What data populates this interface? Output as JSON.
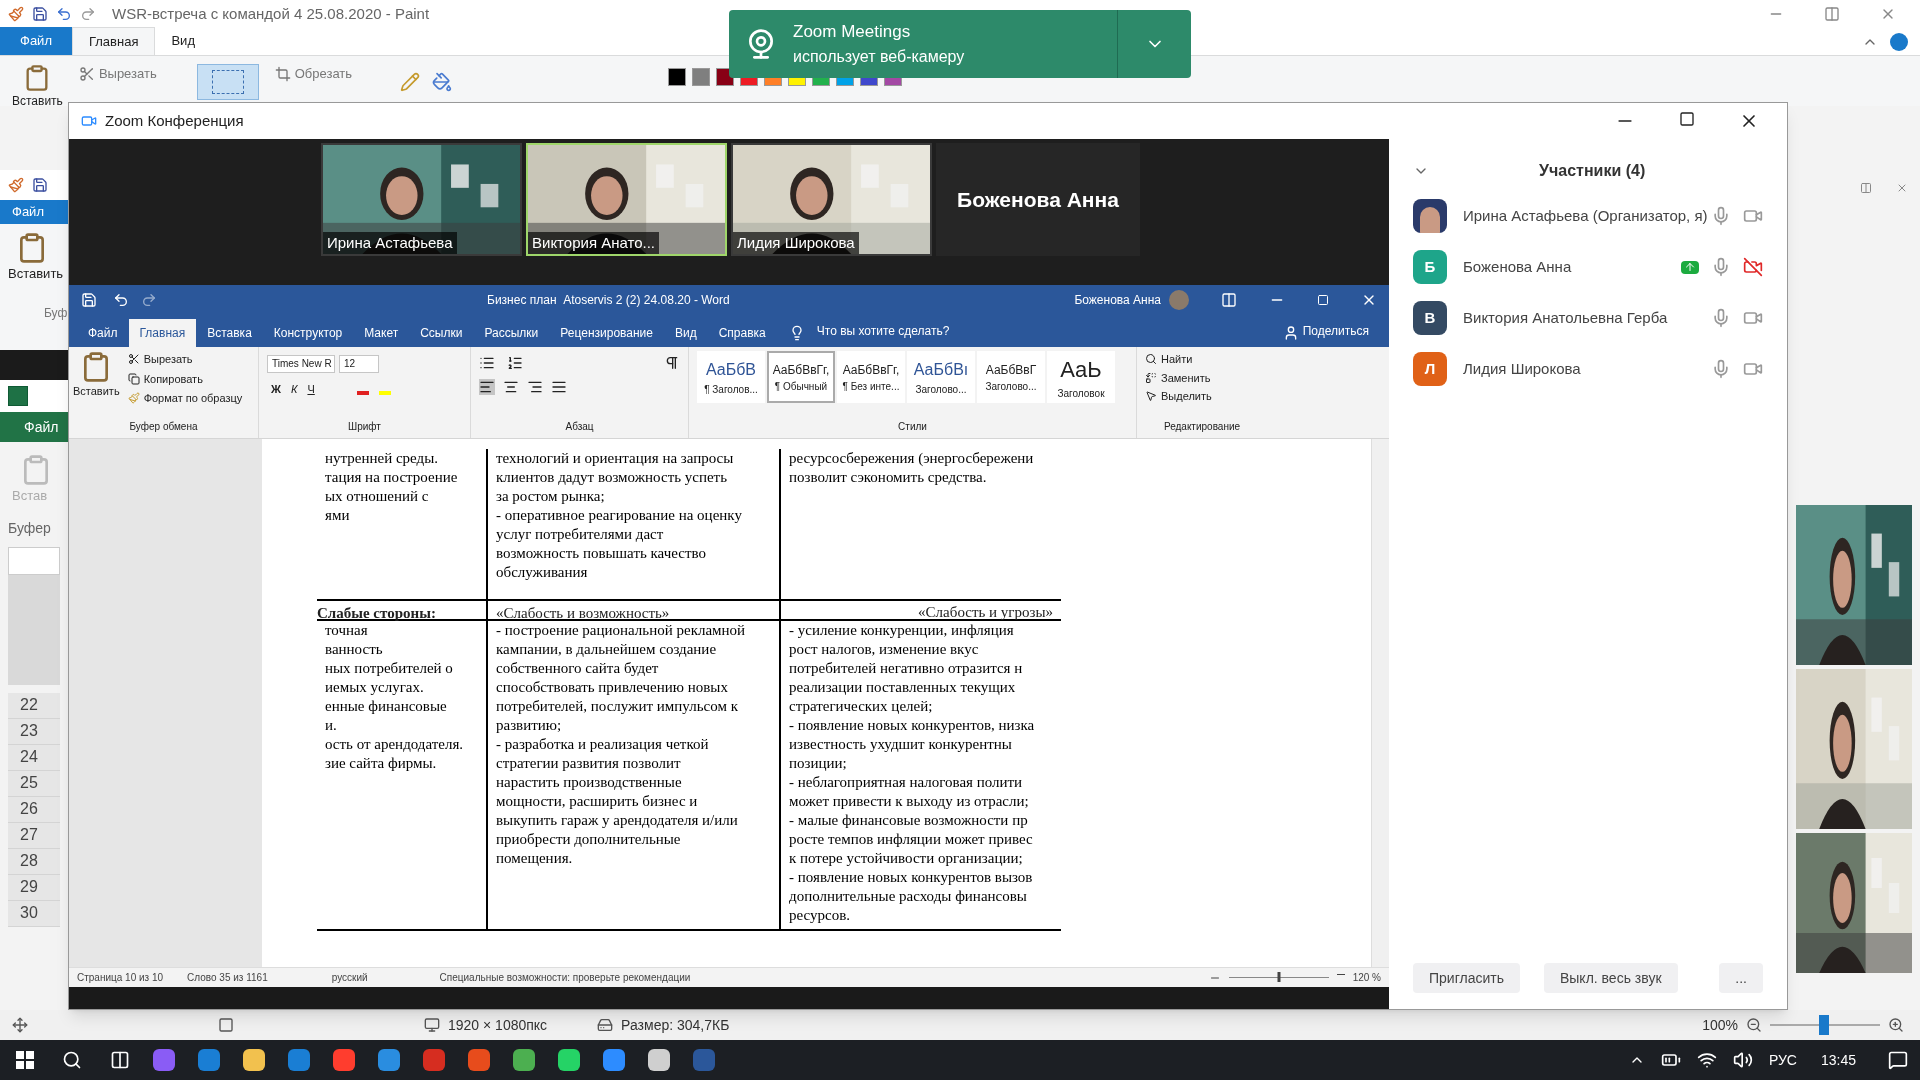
{
  "paint": {
    "title": "WSR-встреча с командой 4 25.08.2020 - Paint",
    "tabs": [
      {
        "label": "Файл",
        "kind": "file",
        "selected": false
      },
      {
        "label": "Главная",
        "kind": "tab",
        "selected": true
      },
      {
        "label": "Вид",
        "kind": "tab",
        "selected": false
      }
    ],
    "ribbon": {
      "paste": "Вставить",
      "cut": "Вырезать",
      "crop": "Обрезать"
    },
    "status": {
      "dimensions": "1920 × 1080пкс",
      "size": "Размер: 304,7КБ",
      "zoom": "100%",
      "level": 0.49
    }
  },
  "toast": {
    "title": "Zoom Meetings",
    "message": "использует веб-камеру"
  },
  "paint_back": {
    "file": "Файл",
    "paste": "Вставить",
    "group": "Буф"
  },
  "excel": {
    "file": "Файл",
    "paste": "Встав",
    "group": "Буфер",
    "rows": [
      "22",
      "23",
      "24",
      "25",
      "26",
      "27",
      "28",
      "29",
      "30"
    ]
  },
  "zoom": {
    "title": "Zoom Конференция",
    "videos": [
      {
        "name": "Ирина Астафьева",
        "selected": false
      },
      {
        "name": "Виктория Анато...",
        "selected": true
      },
      {
        "name": "Лидия Широкова",
        "selected": false
      }
    ],
    "name_tile": "Боженова Анна",
    "participants": {
      "title": "Участники (4)",
      "items": [
        {
          "name": "Ирина Астафьева (Организатор, я)",
          "video_off": false,
          "sharing": false
        },
        {
          "name": "Боженова Анна",
          "kind": "initial",
          "initial": "Б",
          "color": "#1ea58a",
          "video_off": true,
          "sharing": true
        },
        {
          "name": "Виктория Анатольевна Герба",
          "kind": "initial",
          "initial": "В",
          "color": "#344a63",
          "video_off": false,
          "sharing": false
        },
        {
          "name": "Лидия Широкова",
          "kind": "initial",
          "initial": "Л",
          "color": "#e06117",
          "video_off": false,
          "sharing": false
        }
      ]
    },
    "buttons": [
      "Пригласить",
      "Выкл. весь звук",
      "..."
    ]
  },
  "word": {
    "title": "Бизнес план  Atoservis 2 (2) 24.08.20 - Word",
    "user": "Боженова Анна",
    "tabs": [
      {
        "label": "Файл",
        "selected": false
      },
      {
        "label": "Главная",
        "selected": true
      },
      {
        "label": "Вставка",
        "selected": false
      },
      {
        "label": "Конструктор",
        "selected": false
      },
      {
        "label": "Макет",
        "selected": false
      },
      {
        "label": "Ссылки",
        "selected": false
      },
      {
        "label": "Рассылки",
        "selected": false
      },
      {
        "label": "Рецензирование",
        "selected": false
      },
      {
        "label": "Вид",
        "selected": false
      },
      {
        "label": "Справка",
        "selected": false
      }
    ],
    "tell_me": "Что вы хотите сделать?",
    "share": "Поделиться",
    "clipboard": {
      "paste": "Вставить",
      "cut": "Вырезать",
      "copy": "Копировать",
      "format": "Формат по образцу",
      "group": "Буфер обмена"
    },
    "font": {
      "name": "Times New R",
      "size": "12",
      "format": [
        "Ж",
        "К",
        "Ч"
      ],
      "group": "Шрифт"
    },
    "paragraph": {
      "group": "Абзац"
    },
    "styles": {
      "group": "Стили",
      "items": [
        {
          "preview": "АаБбВ",
          "label": "¶ Заголов...",
          "selected": false
        },
        {
          "preview": "АаБбВвГг,",
          "label": "¶ Обычный",
          "selected": true
        },
        {
          "preview": "АаБбВвГг,",
          "label": "¶ Без инте...",
          "selected": false
        },
        {
          "preview": "АаБбВı",
          "label": "Заголово...",
          "selected": false
        },
        {
          "preview": "АаБбВвГ",
          "label": "Заголово...",
          "selected": false
        },
        {
          "preview": "АаЬ",
          "label": "Заголовок",
          "selected": false
        }
      ]
    },
    "editing": {
      "find": "Найти",
      "replace": "Заменить",
      "select": "Выделить",
      "group": "Редактирование"
    },
    "table": {
      "top_row": [
        [
          "нутренней среды.",
          "тация на построение",
          "ых отношений с",
          "ями"
        ],
        [
          "технологий и ориентация на запросы",
          "клиентов дадут возможность успеть",
          "за ростом рынка;",
          "- оперативное реагирование на оценку",
          "услуг потребителями даст",
          "возможность повышать качество",
          "обслуживания"
        ],
        [
          "ресурсосбережения (энергосбережени",
          "позволит сэкономить средства."
        ]
      ],
      "header": [
        "Слабые стороны:",
        "«Слабость и возможность»",
        "«Слабость и угрозы»"
      ],
      "body_row": [
        [
          "точная",
          "ванность",
          "ных потребителей о",
          "иемых услугах.",
          "енные финансовые",
          "и.",
          "ость от арендодателя.",
          "зие сайта фирмы."
        ],
        [
          "- построение рациональной рекламной",
          "кампании, в дальнейшем создание",
          "собственного сайта будет",
          "способствовать привлечению новых",
          "потребителей, послужит импульсом к",
          "развитию;",
          "- разработка и реализация четкой",
          "стратегии развития позволит",
          "нарастить производственные",
          "мощности, расширить бизнес и",
          "выкупить гараж у арендодателя и/или",
          "приобрести дополнительные",
          "помещения."
        ],
        [
          "- усиление конкуренции, инфляция",
          "рост налогов, изменение вкус",
          "потребителей негативно отразится н",
          "реализации поставленных текущих",
          "стратегических целей;",
          "- появление новых конкурентов, низка",
          "известность ухудшит конкурентны",
          "позиции;",
          "- неблагоприятная налоговая полити",
          "может привести к выходу из отрасли;",
          "- малые финансовые возможности пр",
          "росте темпов инфляции может привес",
          "к потере устойчивости организации;",
          "- появление новых конкурентов вызов",
          "дополнительные расходы финансовы",
          "ресурсов."
        ]
      ]
    },
    "status": {
      "page": "Страница 10 из 10",
      "words": "Слово 35 из 1161",
      "language": "русский",
      "accessibility": "Специальные возможности: проверьте рекомендации",
      "zoom": "120 %",
      "level": 0.5
    }
  },
  "taskbar": {
    "language": "РУС",
    "time": "13:45"
  }
}
